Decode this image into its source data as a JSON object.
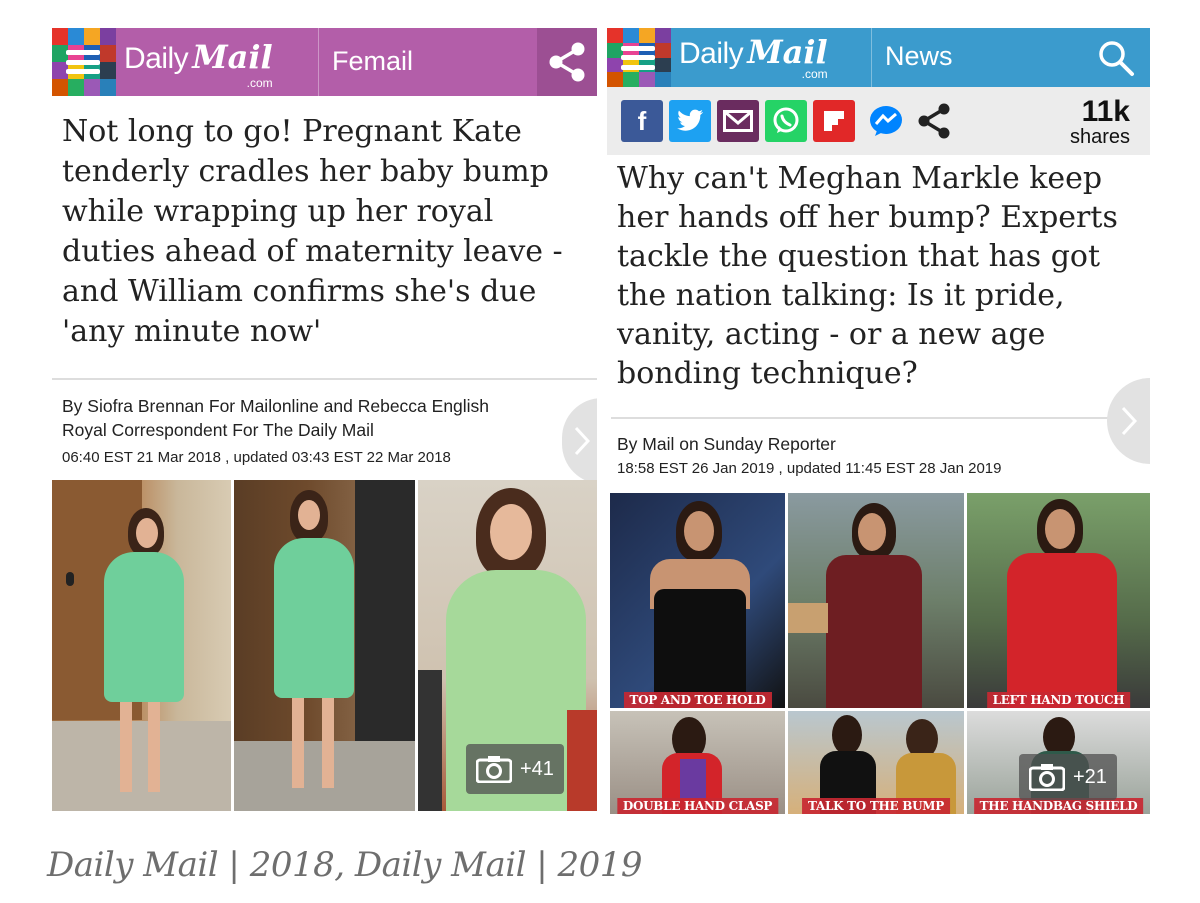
{
  "left": {
    "brand": {
      "daily": "Daily",
      "mail": "Mail",
      "com": ".com"
    },
    "section": "Femail",
    "headline": "Not long to go! Pregnant Kate tenderly cradles her baby bump while wrapping up her royal duties ahead of maternity leave - and William confirms she's due 'any minute now'",
    "byline_line1": "By Siofra Brennan For Mailonline and Rebecca English",
    "byline_line2": "Royal Correspondent For The Daily Mail",
    "dateline": "06:40 EST 21 Mar 2018 , updated 03:43 EST 22 Mar 2018",
    "gallery_count": "+41",
    "colors": {
      "bar": "#b35ea9",
      "share": "#9c4f93"
    }
  },
  "right": {
    "brand": {
      "daily": "Daily",
      "mail": "Mail",
      "com": ".com"
    },
    "section": "News",
    "share_count": "11k",
    "share_label": "shares",
    "headline": "Why can't Meghan Markle keep her hands off her bump? Experts tackle the question that has got the nation talking: Is it pride, vanity, acting - or a new age bonding technique?",
    "byline": "By Mail on Sunday Reporter",
    "dateline": "18:58 EST 26 Jan 2019 , updated 11:45 EST 28 Jan 2019",
    "captions": {
      "top_and_toe": "TOP AND TOE HOLD",
      "left_hand": "LEFT HAND TOUCH",
      "double_hand": "DOUBLE HAND CLASP",
      "talk_bump": "TALK TO THE BUMP",
      "handbag": "THE HANDBAG SHIELD"
    },
    "gallery_count": "+21",
    "share_icons": [
      "facebook-icon",
      "twitter-icon",
      "email-icon",
      "whatsapp-icon",
      "flipboard-icon",
      "messenger-icon",
      "share-icon"
    ],
    "colors": {
      "bar": "#3b9bcd",
      "facebook": "#3b5998",
      "twitter": "#1da1f2",
      "email": "#6a2c5f",
      "whatsapp": "#25d366",
      "flipboard": "#e12828",
      "messenger": "#0084ff"
    }
  },
  "credit": "Daily Mail | 2018, Daily Mail | 2019"
}
